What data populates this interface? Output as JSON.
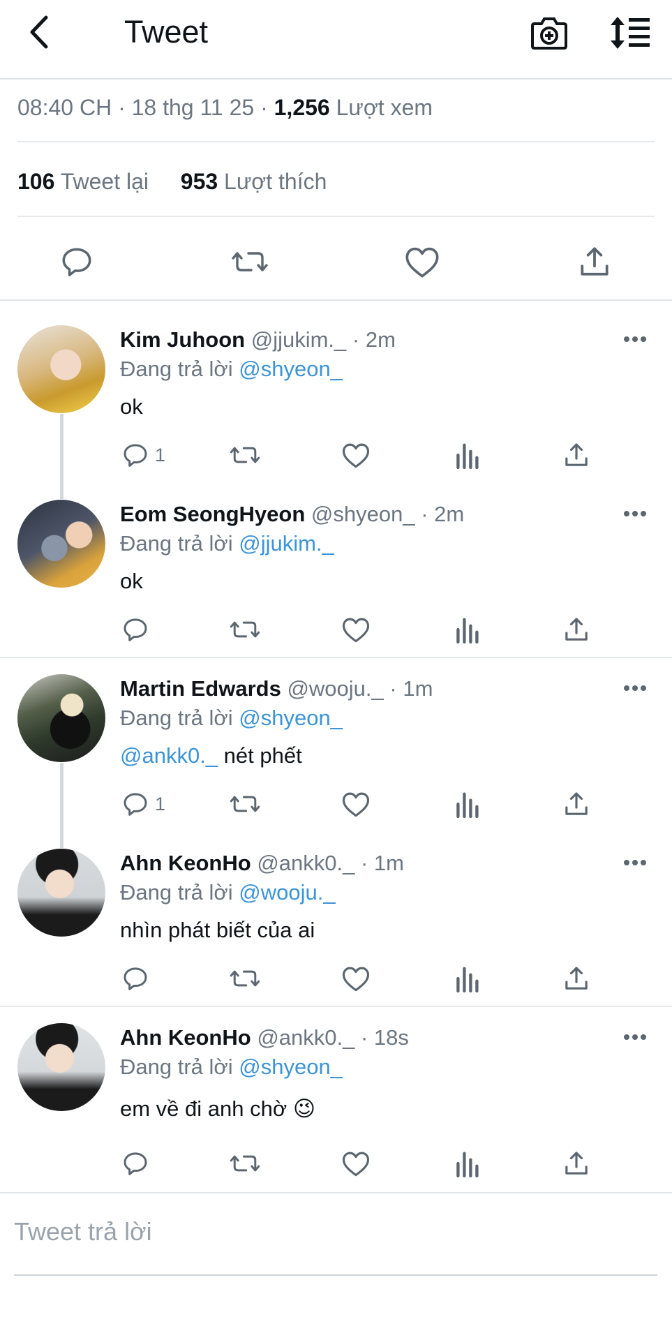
{
  "header": {
    "title": "Tweet",
    "back_icon": "chevron-left-icon",
    "camera_icon": "camera-plus-icon",
    "sort_icon": "sort-list-icon"
  },
  "tweet": {
    "time": "08:40 CH · 18 thg 11 25 ·",
    "views_count": "1,256",
    "views_label": "Lượt xem",
    "retweets_count": "106",
    "retweets_label": "Tweet lại",
    "likes_count": "953",
    "likes_label": "Lượt thích"
  },
  "replies": [
    {
      "name": "Kim Juhoon",
      "handle": "@jjukim._",
      "time": "· 2m",
      "reply_prefix": "Đang trả lời",
      "reply_to": "@shyeon_",
      "text": "ok",
      "mention": "",
      "reply_count": "1",
      "avatar_colors": [
        "#c99a2e",
        "#f3d24a"
      ]
    },
    {
      "name": "Eom SeongHyeon",
      "handle": "@shyeon_",
      "time": "· 2m",
      "reply_prefix": "Đang trả lời",
      "reply_to": "@jjukim._",
      "text": "ok",
      "mention": "",
      "reply_count": "",
      "avatar_colors": [
        "#3a4152",
        "#d9a23a"
      ]
    },
    {
      "name": "Martin Edwards",
      "handle": "@wooju._",
      "time": "· 1m",
      "reply_prefix": "Đang trả lời",
      "reply_to": "@shyeon_",
      "text": " nét phết",
      "mention": "@ankk0._",
      "reply_count": "1",
      "avatar_colors": [
        "#2f3b2c",
        "#1c1c1c"
      ]
    },
    {
      "name": "Ahn KeonHo",
      "handle": "@ankk0._",
      "time": "· 1m",
      "reply_prefix": "Đang trả lời",
      "reply_to": "@wooju._",
      "text": "nhìn phát biết của ai",
      "mention": "",
      "reply_count": "",
      "avatar_colors": [
        "#cfd3d6",
        "#1b1b1b"
      ]
    },
    {
      "name": "Ahn KeonHo",
      "handle": "@ankk0._",
      "time": "· 18s",
      "reply_prefix": "Đang trả lời",
      "reply_to": "@shyeon_",
      "text": "em về đi anh chờ",
      "mention": "",
      "emoji": "😉",
      "reply_count": "",
      "avatar_colors": [
        "#d5d8db",
        "#1b1b1b"
      ]
    }
  ],
  "compose": {
    "placeholder": "Tweet trả lời"
  },
  "colors": {
    "link": "#3b94d9",
    "muted": "#6b7682",
    "icon": "#5b6670",
    "text": "#0f1419"
  }
}
